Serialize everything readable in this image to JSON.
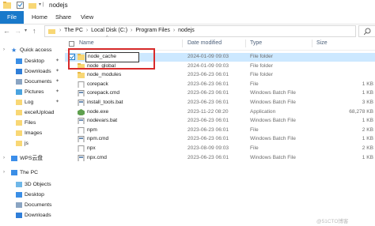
{
  "window": {
    "title": "nodejs"
  },
  "ribbon": {
    "tabs": [
      "File",
      "Home",
      "Share",
      "View"
    ]
  },
  "address": {
    "crumbs": [
      "The PC",
      "Local Disk (C:)",
      "Program Files",
      "nodejs"
    ]
  },
  "sidebar": {
    "items": [
      {
        "label": "Quick access",
        "icon": "star-icon",
        "pinned": false
      },
      {
        "label": "Desktop",
        "icon": "desktop-icon",
        "pinned": true
      },
      {
        "label": "Downloads",
        "icon": "download-icon",
        "pinned": true
      },
      {
        "label": "Documents",
        "icon": "document-icon",
        "pinned": true
      },
      {
        "label": "Pictures",
        "icon": "picture-icon",
        "pinned": true
      },
      {
        "label": "Log",
        "icon": "folder-icon",
        "pinned": true
      },
      {
        "label": "excelUpload",
        "icon": "folder-icon",
        "pinned": false
      },
      {
        "label": "Files",
        "icon": "folder-icon",
        "pinned": false
      },
      {
        "label": "Images",
        "icon": "folder-icon",
        "pinned": false
      },
      {
        "label": "js",
        "icon": "folder-icon",
        "pinned": false
      },
      {
        "label": "WPS云盘",
        "icon": "cloud-icon",
        "pinned": false
      },
      {
        "label": "The PC",
        "icon": "computer-icon",
        "pinned": false
      },
      {
        "label": "3D Objects",
        "icon": "cube-icon",
        "pinned": false
      },
      {
        "label": "Desktop",
        "icon": "desktop-icon",
        "pinned": false
      },
      {
        "label": "Documents",
        "icon": "document-icon",
        "pinned": false
      },
      {
        "label": "Downloads",
        "icon": "download-icon",
        "pinned": false
      }
    ]
  },
  "columns": {
    "name": "Name",
    "date": "Date modified",
    "type": "Type",
    "size": "Size"
  },
  "files": [
    {
      "name": "node_cache",
      "date": "2024-01-09 09:03",
      "type": "File folder",
      "size": "",
      "icon": "folder-icon",
      "selected": true
    },
    {
      "name": "node_global",
      "date": "2024-01-09 09:03",
      "type": "File folder",
      "size": "",
      "icon": "folder-icon",
      "selected": false
    },
    {
      "name": "node_modules",
      "date": "2023-06-23 06:01",
      "type": "File folder",
      "size": "",
      "icon": "folder-icon",
      "selected": false
    },
    {
      "name": "corepack",
      "date": "2023-06-23 06:01",
      "type": "File",
      "size": "1 KB",
      "icon": "file-icon",
      "selected": false
    },
    {
      "name": "corepack.cmd",
      "date": "2023-06-23 06:01",
      "type": "Windows Batch File",
      "size": "1 KB",
      "icon": "batch-icon",
      "selected": false
    },
    {
      "name": "install_tools.bat",
      "date": "2023-06-23 06:01",
      "type": "Windows Batch File",
      "size": "3 KB",
      "icon": "batch-icon",
      "selected": false
    },
    {
      "name": "node.exe",
      "date": "2023-11-22 08:20",
      "type": "Application",
      "size": "68,278 KB",
      "icon": "node-icon",
      "selected": false
    },
    {
      "name": "nodevars.bat",
      "date": "2023-06-23 06:01",
      "type": "Windows Batch File",
      "size": "1 KB",
      "icon": "batch-icon",
      "selected": false
    },
    {
      "name": "npm",
      "date": "2023-06-23 06:01",
      "type": "File",
      "size": "2 KB",
      "icon": "file-icon",
      "selected": false
    },
    {
      "name": "npm.cmd",
      "date": "2023-06-23 06:01",
      "type": "Windows Batch File",
      "size": "1 KB",
      "icon": "batch-icon",
      "selected": false
    },
    {
      "name": "npx",
      "date": "2023-08-09 09:03",
      "type": "File",
      "size": "2 KB",
      "icon": "file-icon",
      "selected": false
    },
    {
      "name": "npx.cmd",
      "date": "2023-06-23 06:01",
      "type": "Windows Batch File",
      "size": "1 KB",
      "icon": "batch-icon",
      "selected": false
    }
  ],
  "watermark": "@51CTO博客",
  "colors": {
    "accent": "#1979ca",
    "selection": "#cce8ff",
    "highlight_box": "#d82b2b",
    "folder": "#f8d775"
  }
}
